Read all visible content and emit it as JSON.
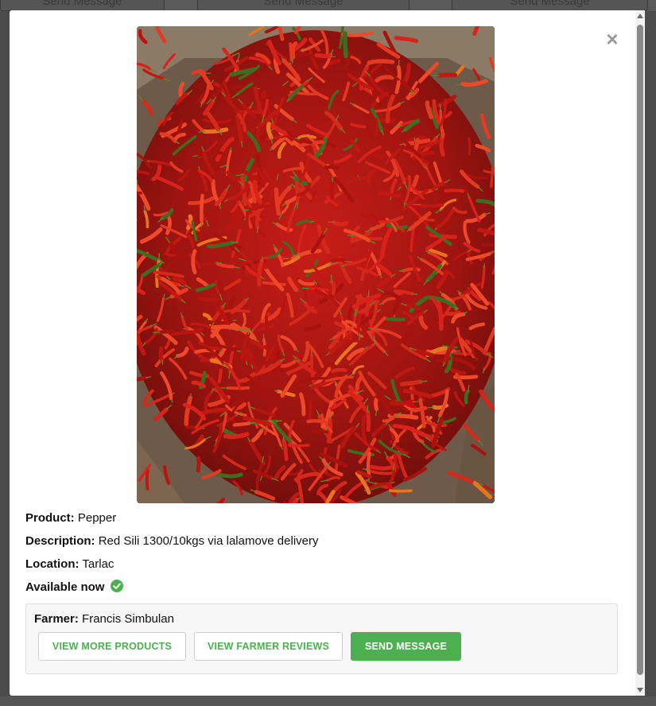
{
  "background": {
    "buttons": [
      "Send Message",
      "Send Message",
      "Send Message"
    ]
  },
  "modal": {
    "close_glyph": "×",
    "photo_alt": "Red chili peppers",
    "product_label": "Product:",
    "product_value": "Pepper",
    "description_label": "Description:",
    "description_value": "Red Sili 1300/10kgs via lalamove delivery",
    "location_label": "Location:",
    "location_value": "Tarlac",
    "availability": "Available now",
    "farmer_label": "Farmer:",
    "farmer_value": "Francis Simbulan",
    "buttons": {
      "view_more": "VIEW MORE PRODUCTS",
      "reviews": "VIEW FARMER REVIEWS",
      "send": "SEND MESSAGE"
    }
  },
  "colors": {
    "accent": "#4caf50",
    "close": "#9a9a9a",
    "backdrop": "#4b4b4b"
  }
}
